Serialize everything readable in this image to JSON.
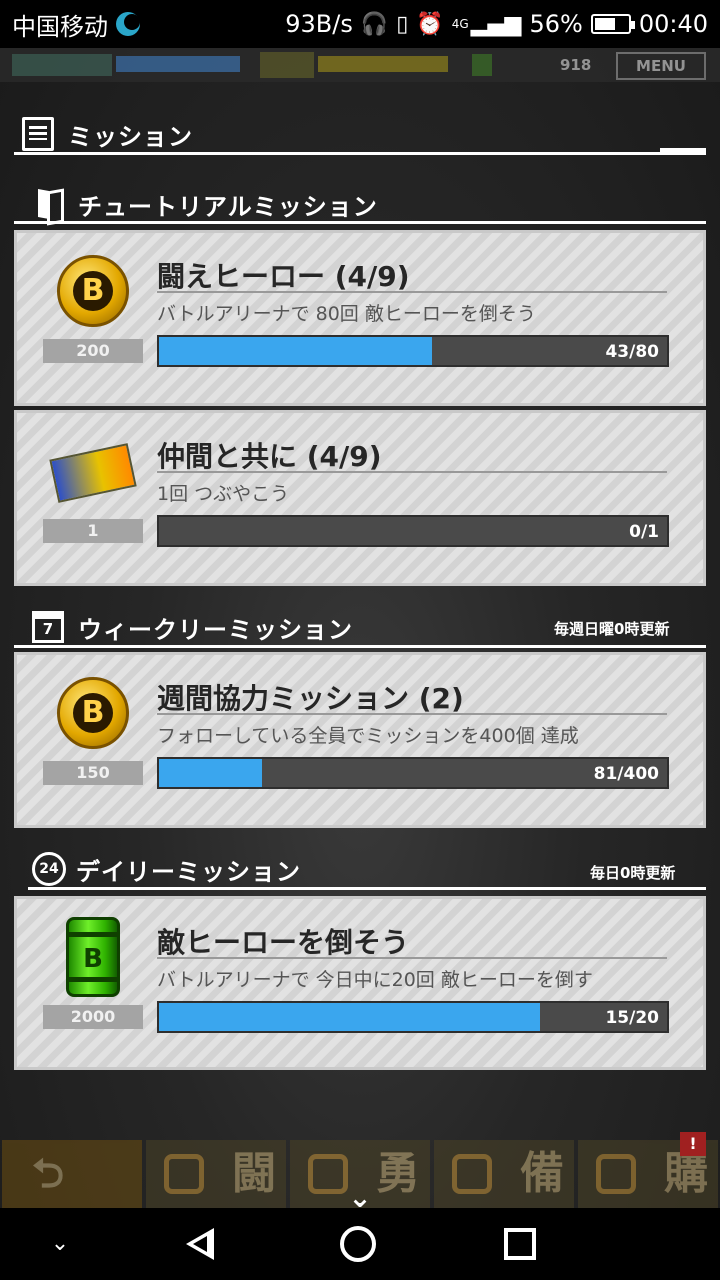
{
  "status_bar": {
    "carrier": "中国移动",
    "speed": "93B/s",
    "signal": "4G",
    "battery": "56%",
    "time": "00:40",
    "icons": [
      "moon-icon",
      "headphones-icon",
      "vibrate-icon",
      "alarm-icon",
      "signal-icon",
      "battery-icon"
    ]
  },
  "top_bar": {
    "coins": "918",
    "menu_label": "MENU"
  },
  "header": {
    "title": "ミッション"
  },
  "sections": {
    "tutorial": {
      "title": "チュートリアルミッション",
      "missions": [
        {
          "title": "闘えヒーロー (4/9)",
          "desc": "バトルアリーナで 80回 敵ヒーローを倒そう",
          "reward_count": "200",
          "reward_icon": "hero-coin-icon",
          "progress_label": "43/80",
          "progress": 0.5375
        },
        {
          "title": "仲間と共に (4/9)",
          "desc": "1回 つぶやこう",
          "reward_count": "1",
          "reward_icon": "ticket-icon",
          "progress_label": "0/1",
          "progress": 0
        }
      ]
    },
    "weekly": {
      "title": "ウィークリーミッション",
      "note": "毎週日曜0時更新",
      "missions": [
        {
          "title": "週間協力ミッション (2)",
          "desc": "フォローしている全員でミッションを400個 達成",
          "reward_count": "150",
          "reward_icon": "hero-coin-icon",
          "progress_label": "81/400",
          "progress": 0.2025
        }
      ]
    },
    "daily": {
      "title": "デイリーミッション",
      "note": "毎日0時更新",
      "missions": [
        {
          "title": "敵ヒーローを倒そう",
          "desc": "バトルアリーナで 今日中に20回 敵ヒーローを倒す",
          "reward_count": "2000",
          "reward_icon": "green-can-icon",
          "progress_label": "15/20",
          "progress": 0.75
        }
      ]
    }
  },
  "game_nav": {
    "items": [
      "闘",
      "勇",
      "備",
      "購"
    ],
    "badge": "!"
  },
  "colors": {
    "progress_fill": "#3aa6ee",
    "progress_track": "#4a4a4a",
    "card_bg": "#dcdcdc"
  }
}
